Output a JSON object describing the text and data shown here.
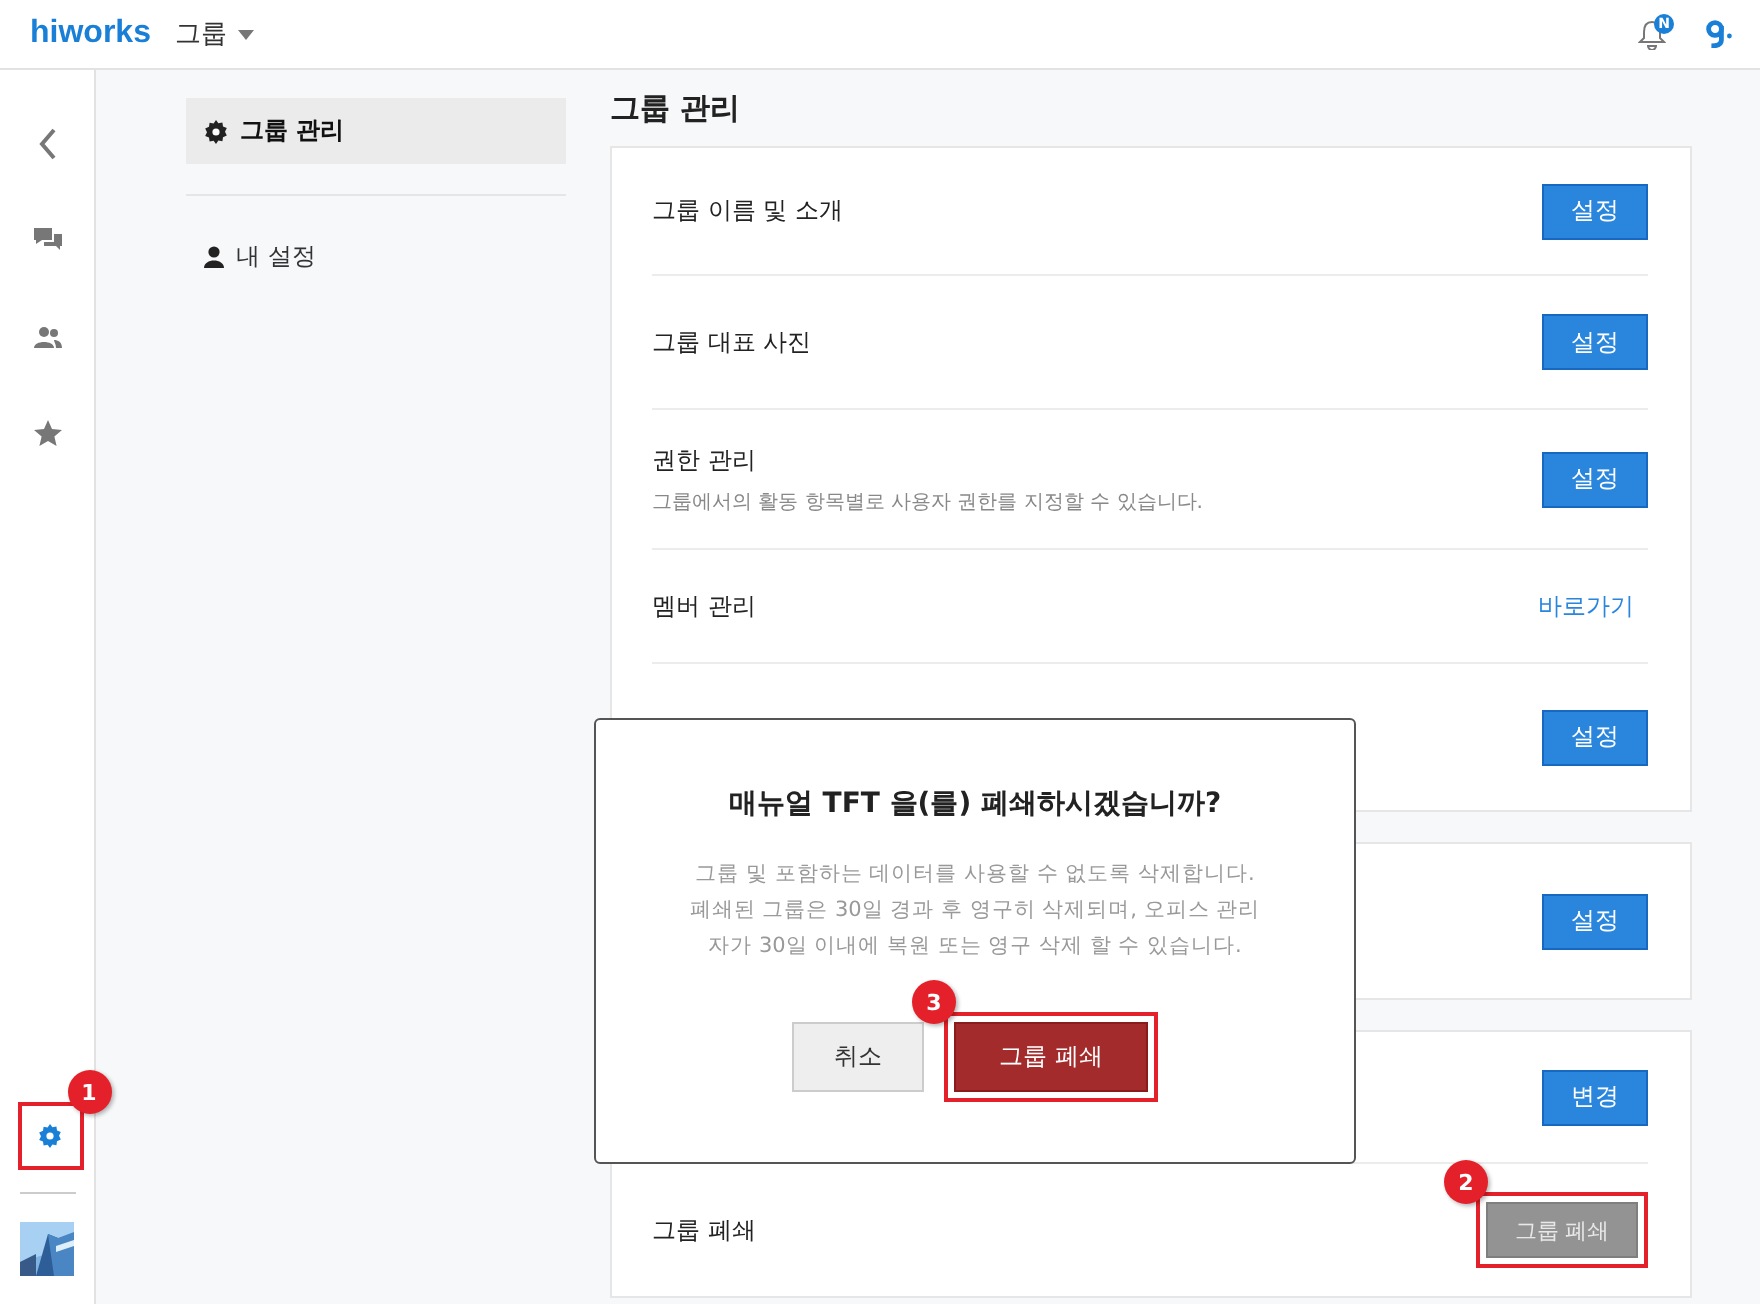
{
  "top_bar": {
    "logo": "hiworks",
    "menu": "그룹",
    "notification_badge": "N"
  },
  "rail": {
    "items": [
      {
        "kind": "back",
        "selected": false
      },
      {
        "kind": "chat",
        "selected": false
      },
      {
        "kind": "people",
        "selected": false
      },
      {
        "kind": "star",
        "selected": false
      }
    ],
    "settings": {
      "selected": true,
      "annotation": "1"
    }
  },
  "nav": [
    {
      "label": "그룹 관리",
      "kind": "gear",
      "selected": true
    },
    {
      "label": "내 설정",
      "kind": "person",
      "selected": false
    }
  ],
  "title": "그룹 관리",
  "cards": [
    {
      "rows": [
        {
          "label": "그룹 이름 및 소개",
          "action": {
            "kind": "button",
            "label": "설정"
          }
        },
        {
          "label": "그룹 대표 사진",
          "action": {
            "kind": "button",
            "label": "설정"
          }
        },
        {
          "label": "권한 관리",
          "description": "그룹에서의 활동 항목별로 사용자 권한를 지정할 수 있습니다.",
          "action": {
            "kind": "button",
            "label": "설정"
          }
        },
        {
          "label": "멤버 관리",
          "action": {
            "kind": "link",
            "label": "바로가기"
          }
        },
        {
          "action": {
            "kind": "button",
            "label": "설정"
          }
        }
      ]
    },
    {
      "rows": [
        {
          "action": {
            "kind": "button",
            "label": "설정"
          }
        }
      ]
    },
    {
      "rows": [
        {
          "action": {
            "kind": "button",
            "label": "변경"
          }
        },
        {
          "label": "그룹 폐쇄",
          "action": {
            "kind": "muted",
            "label": "그룹 폐쇄",
            "annotation": "2"
          }
        }
      ]
    }
  ],
  "dialog": {
    "title": "매뉴얼 TFT 을(를) 폐쇄하시겠습니까?",
    "message": "그룹 및 포함하는 데이터를 사용할 수 없도록 삭제합니다. 폐쇄된 그룹은 30일 경과 후 영구히 삭제되며, 오피스 관리자가 30일 이내에 복원 또는 영구 삭제 할 수 있습니다.",
    "buttons": [
      {
        "kind": "secondary",
        "label": "취소"
      },
      {
        "kind": "danger",
        "label": "그룹 폐쇄",
        "annotation": "3"
      }
    ]
  }
}
